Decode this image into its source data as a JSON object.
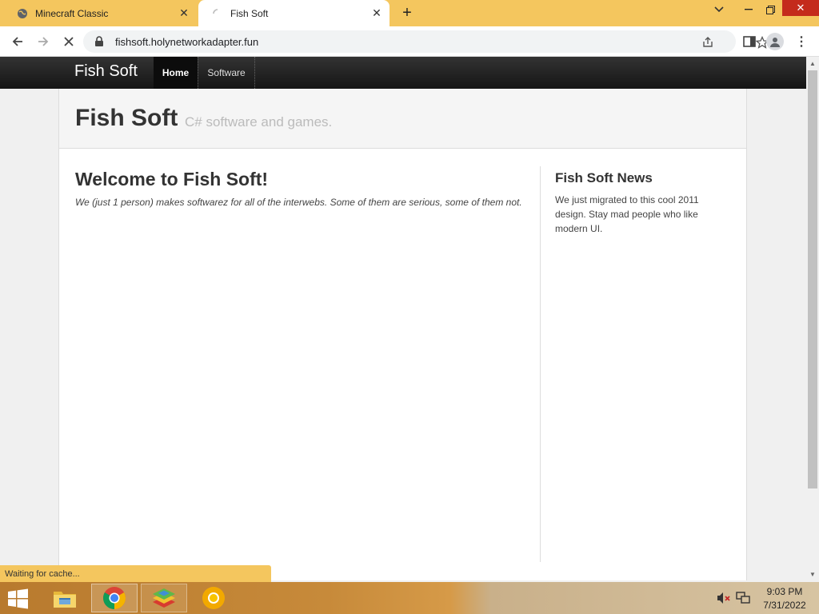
{
  "browser": {
    "tabs": [
      {
        "title": "Minecraft Classic",
        "active": false,
        "favicon": "globe-icon"
      },
      {
        "title": "Fish Soft",
        "active": true,
        "favicon": "loading-spinner-icon"
      }
    ],
    "url": "fishsoft.holynetworkadapter.fun",
    "status": "Waiting for cache...",
    "accent_color": "#f4c65e"
  },
  "site": {
    "brand": "Fish Soft",
    "nav": [
      {
        "label": "Home",
        "active": true
      },
      {
        "label": "Software",
        "active": false
      }
    ],
    "hero": {
      "title": "Fish Soft",
      "subtitle": "C# software and games."
    },
    "main": {
      "heading": "Welcome to Fish Soft!",
      "intro": "We (just 1 person) makes softwarez for all of the interwebs. Some of them are serious, some of them not."
    },
    "sidebar": {
      "heading": "Fish Soft News",
      "text": "We just migrated to this cool 2011 design. Stay mad people who like modern UI."
    }
  },
  "taskbar": {
    "apps": [
      "file-explorer-icon",
      "chrome-icon",
      "bluestacks-icon",
      "chrome-canary-icon"
    ],
    "clock": {
      "time": "9:03 PM",
      "date": "7/31/2022"
    }
  }
}
